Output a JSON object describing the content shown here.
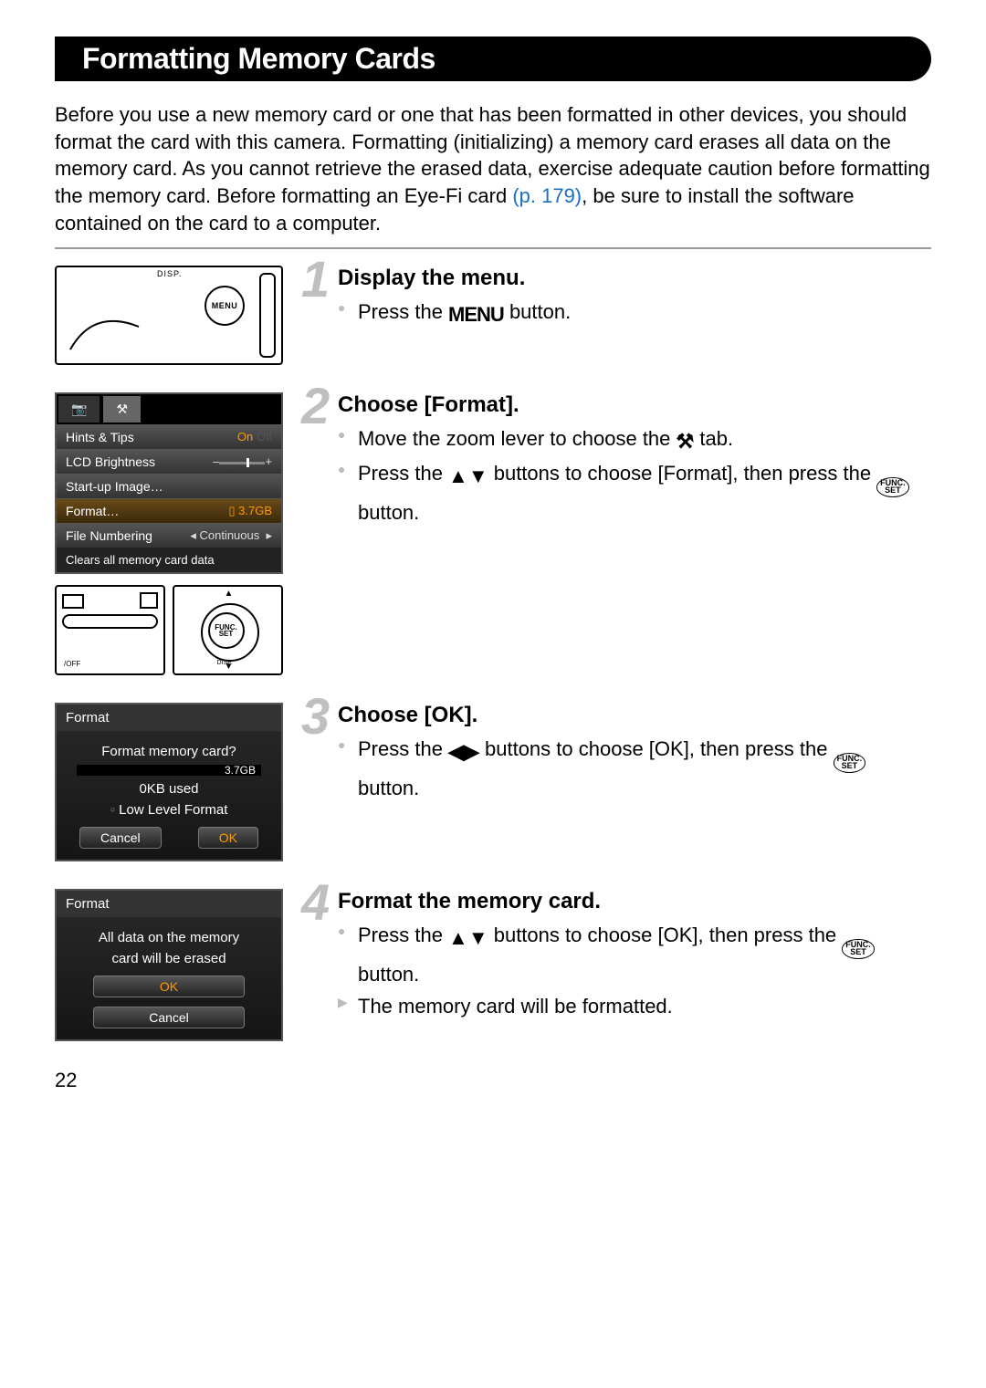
{
  "title": "Formatting Memory Cards",
  "intro_pre": "Before you use a new memory card or one that has been formatted in other devices, you should format the card with this camera. Formatting (initializing) a memory card erases all data on the memory card. As you cannot retrieve the erased data, exercise adequate caution before formatting the memory card. Before formatting an Eye-Fi card ",
  "intro_link": "(p. 179)",
  "intro_post": ", be sure to install the software contained on the card to a computer.",
  "page_number": "22",
  "illus": {
    "menu_label": "MENU",
    "disp_label": "DISP.",
    "func_l1": "FUNC.",
    "func_l2": "SET"
  },
  "lcd_menu": {
    "tab_camera": "📷",
    "tab_tools": "⚒",
    "rows": [
      {
        "label": "Hints & Tips",
        "value": "On"
      },
      {
        "label": "LCD Brightness",
        "value": ""
      },
      {
        "label": "Start-up Image…",
        "value": ""
      },
      {
        "label": "Format…",
        "value": "3.7GB"
      },
      {
        "label": "File Numbering",
        "value": "Continuous"
      }
    ],
    "caption": "Clears all memory card data"
  },
  "dlg_format": {
    "title": "Format",
    "question": "Format memory card?",
    "size": "3.7GB",
    "used": "0KB used",
    "low": "Low Level Format",
    "cancel": "Cancel",
    "ok": "OK"
  },
  "dlg_confirm": {
    "title": "Format",
    "line1": "All data on the memory",
    "line2": "card will be erased",
    "ok": "OK",
    "cancel": "Cancel"
  },
  "steps": [
    {
      "num": "1",
      "head": "Display the menu.",
      "bullets": [
        {
          "type": "dot",
          "text_pre": "Press the ",
          "icon": "MENU",
          "icon_kind": "menu-text",
          "text_post": " button."
        }
      ]
    },
    {
      "num": "2",
      "head": "Choose [Format].",
      "bullets": [
        {
          "type": "dot",
          "text_pre": "Move the zoom lever to choose the ",
          "icon": "⚒",
          "icon_kind": "tools-icon",
          "text_post": " tab."
        },
        {
          "type": "dot",
          "text_pre": "Press the ",
          "icon": "▲▼",
          "icon_kind": "updown-icon",
          "text_mid": " buttons to choose [Format], then press the ",
          "icon2": "FUNC/SET",
          "icon2_kind": "funcset-icon",
          "text_post": " button."
        }
      ]
    },
    {
      "num": "3",
      "head": "Choose [OK].",
      "bullets": [
        {
          "type": "dot",
          "text_pre": "Press the ",
          "icon": "◀▶",
          "icon_kind": "leftright-icon",
          "text_mid": " buttons to choose [OK], then press the ",
          "icon2": "FUNC/SET",
          "icon2_kind": "funcset-icon",
          "text_post": " button."
        }
      ]
    },
    {
      "num": "4",
      "head": "Format the memory card.",
      "bullets": [
        {
          "type": "dot",
          "text_pre": "Press the ",
          "icon": "▲▼",
          "icon_kind": "updown-icon",
          "text_mid": " buttons to choose [OK], then press the ",
          "icon2": "FUNC/SET",
          "icon2_kind": "funcset-icon",
          "text_post": " button."
        },
        {
          "type": "arrow",
          "text_pre": "The memory card will be formatted.",
          "icon": "",
          "text_post": ""
        }
      ]
    }
  ]
}
